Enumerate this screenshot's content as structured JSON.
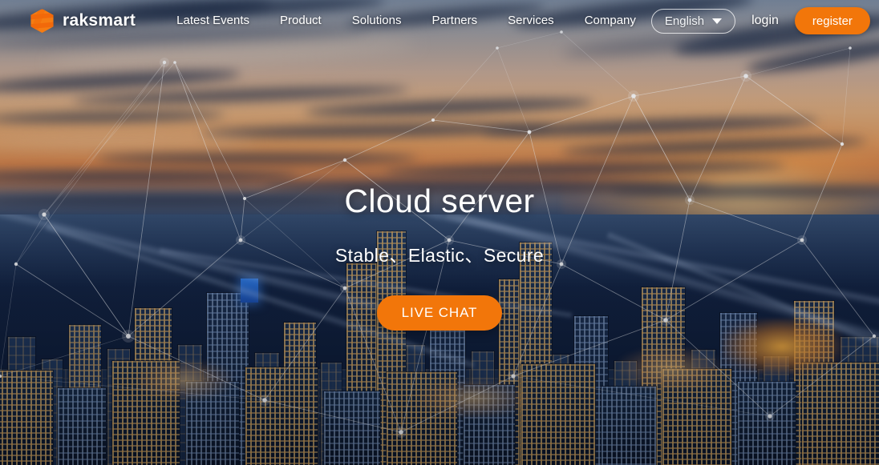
{
  "header": {
    "logo": {
      "icon": "raksmart-hexagon-logo-icon",
      "text": "raksmart",
      "color": "#f2760a"
    },
    "nav": [
      {
        "label": "Latest Events"
      },
      {
        "label": "Product"
      },
      {
        "label": "Solutions"
      },
      {
        "label": "Partners"
      },
      {
        "label": "Services"
      },
      {
        "label": "Company"
      }
    ],
    "language": {
      "selected": "English",
      "caret_icon": "chevron-down-icon"
    },
    "login_label": "login",
    "register_label": "register"
  },
  "hero": {
    "title": "Cloud server",
    "subtitle": "Stable、Elastic、Secure",
    "cta_label": "LIVE CHAT"
  },
  "theme": {
    "accent": "#f2760a",
    "accent_hover": "#ff8a22",
    "text_on_image": "#ffffff",
    "sky_top": "#8d9cb0",
    "sky_horizon": "#d8854a",
    "city_dark": "#0a162c"
  }
}
